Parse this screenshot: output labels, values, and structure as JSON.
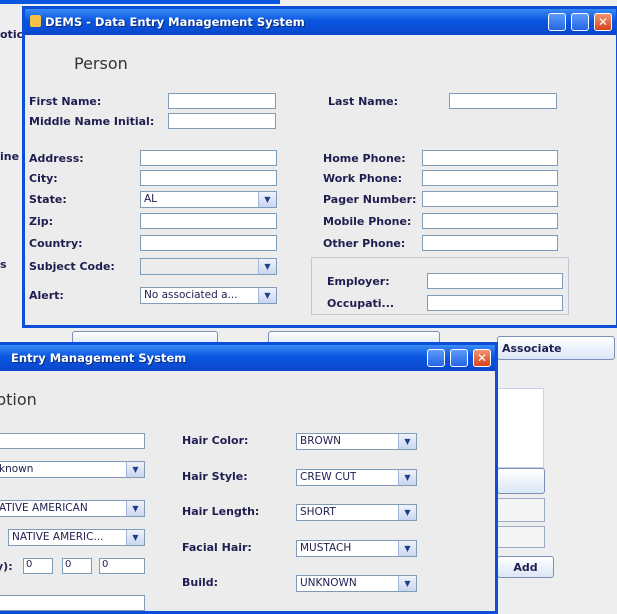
{
  "bg_window": {
    "labels": [
      "otic",
      "ine",
      "s"
    ],
    "associate_button": "Associate",
    "add_button": "Add"
  },
  "win1": {
    "title": "DEMS - Data Entry Management System",
    "section": "Person",
    "labels": {
      "first_name": "First Name:",
      "last_name": "Last Name:",
      "middle": "Middle Name Initial:",
      "address": "Address:",
      "city": "City:",
      "state": "State:",
      "zip": "Zip:",
      "country": "Country:",
      "subject_code": "Subject Code:",
      "alert": "Alert:",
      "home_phone": "Home Phone:",
      "work_phone": "Work Phone:",
      "pager": "Pager Number:",
      "mobile": "Mobile Phone:",
      "other": "Other Phone:",
      "employer": "Employer:",
      "occupation": "Occupati..."
    },
    "values": {
      "state": "AL",
      "alert": "No associated a..."
    }
  },
  "win2": {
    "title": "Entry Management System",
    "section": "ption",
    "left": {
      "combo1": "known",
      "combo2": "ATIVE AMERICAN",
      "combo3": "NATIVE AMERIC...",
      "date_label": "y):",
      "date_values": [
        "0",
        "0",
        "0"
      ]
    },
    "labels": {
      "hair_color": "Hair Color:",
      "hair_style": "Hair Style:",
      "hair_length": "Hair Length:",
      "facial_hair": "Facial Hair:",
      "build": "Build:"
    },
    "values": {
      "hair_color": "BROWN",
      "hair_style": "CREW CUT",
      "hair_length": "SHORT",
      "facial_hair": "MUSTACH",
      "build": "UNKNOWN"
    }
  },
  "colors": {
    "titlebar": "#0a56e0",
    "window_bg": "#ececec",
    "text": "#1e1e50"
  }
}
